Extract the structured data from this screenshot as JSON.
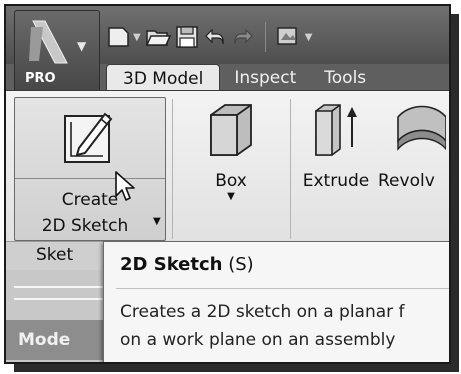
{
  "app": {
    "logo_icon": "inventor-logo-icon",
    "badge": "PRO"
  },
  "quick_access": {
    "icons": [
      "new-file-icon",
      "open-folder-icon",
      "save-icon",
      "undo-icon",
      "redo-icon",
      "appearance-icon"
    ]
  },
  "tabs": [
    {
      "label": "3D Model",
      "active": true
    },
    {
      "label": "Inspect",
      "active": false
    },
    {
      "label": "Tools",
      "active": false
    }
  ],
  "ribbon": {
    "create_sketch": {
      "line1": "Create",
      "line2": "2D Sketch"
    },
    "box_label": "Box",
    "extrude_label": "Extrude",
    "revolve_label": "Revolv",
    "panel_title": "Sket"
  },
  "tooltip": {
    "title": "2D Sketch",
    "shortcut": "(S)",
    "line1": "Creates a 2D sketch on a planar f",
    "line2": "on a work plane on an assembly"
  },
  "browser": {
    "label": "Mode"
  },
  "colors": {
    "title_bar": "#5f5f5f",
    "ribbon_bg": "#ececec",
    "tooltip_bg": "#f6f6f6"
  }
}
